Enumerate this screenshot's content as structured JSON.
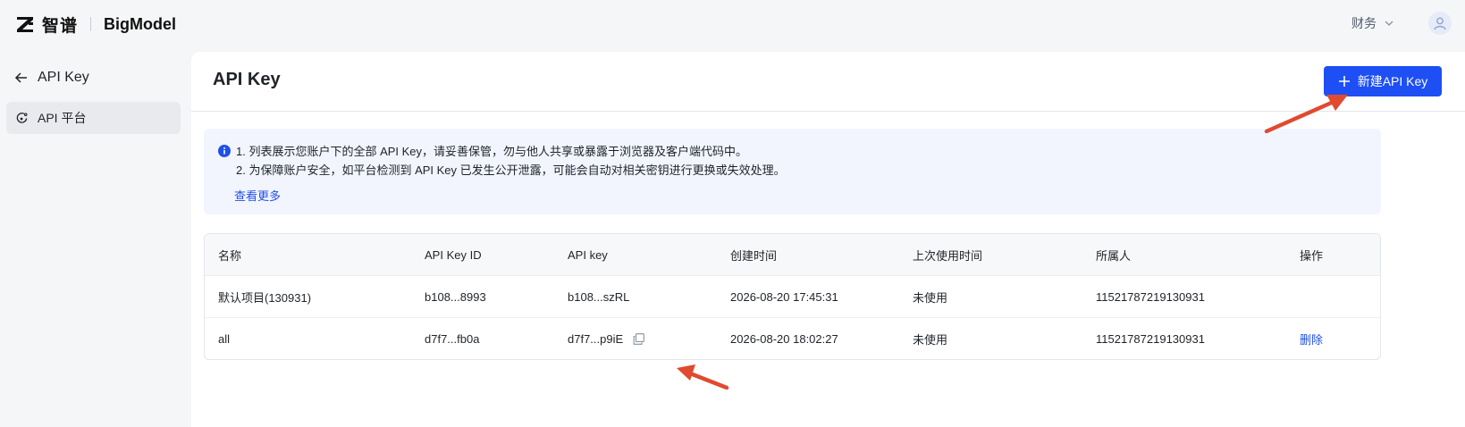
{
  "brand": {
    "name_cn": "智谱",
    "name_en": "BigModel"
  },
  "header": {
    "finance_label": "财务"
  },
  "sidebar": {
    "back_label": "API Key",
    "items": [
      {
        "label": "API 平台",
        "icon": "api-platform-icon"
      }
    ]
  },
  "main": {
    "title": "API Key",
    "new_button_label": "新建API Key",
    "notice": {
      "line1": "1. 列表展示您账户下的全部 API Key，请妥善保管，勿与他人共享或暴露于浏览器及客户端代码中。",
      "line2": "2. 为保障账户安全，如平台检测到 API Key 已发生公开泄露，可能会自动对相关密钥进行更换或失效处理。",
      "more_link": "查看更多"
    },
    "table": {
      "columns": [
        "名称",
        "API Key ID",
        "API key",
        "创建时间",
        "上次使用时间",
        "所属人",
        "操作"
      ],
      "rows": [
        {
          "name": "默认项目(130931)",
          "key_id": "b108...8993",
          "api_key": "b108...szRL",
          "created": "2026-08-20 17:45:31",
          "last_used": "未使用",
          "owner": "11521787219130931",
          "action": ""
        },
        {
          "name": "all",
          "key_id": "d7f7...fb0a",
          "api_key": "d7f7...p9iE",
          "created": "2026-08-20 18:02:27",
          "last_used": "未使用",
          "owner": "11521787219130931",
          "action": "删除"
        }
      ]
    }
  },
  "colors": {
    "primary": "#1d4ff5",
    "link": "#2150e6",
    "annotation_arrow": "#e04a2f",
    "notice_bg": "#f2f5fe"
  }
}
